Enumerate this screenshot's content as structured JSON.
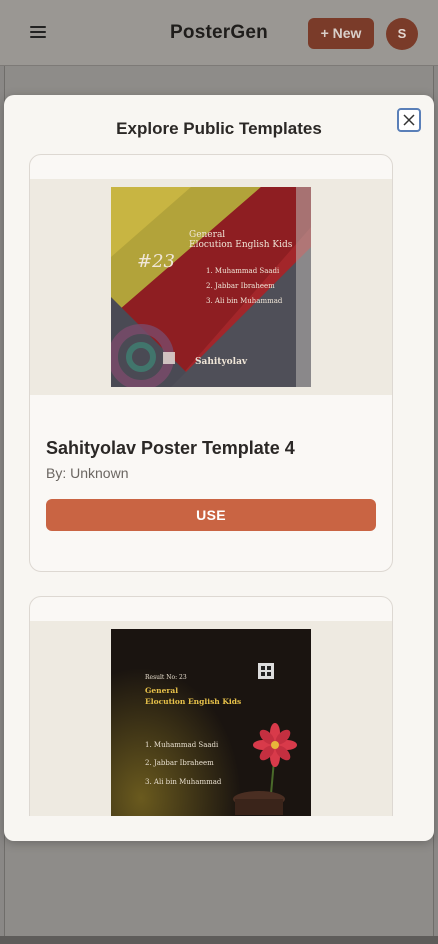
{
  "header": {
    "brand": "PosterGen",
    "new_button": "+ New",
    "avatar_initial": "S",
    "menu_icon": "hamburger-icon"
  },
  "modal": {
    "title": "Explore Public Templates",
    "close_icon": "close-icon"
  },
  "templates": [
    {
      "name": "Sahityolav Poster Template 4",
      "author": "By: Unknown",
      "use_label": "USE",
      "poster": {
        "number": "#23",
        "heading_line1": "General",
        "heading_line2": "Elocution English Kids",
        "entries": [
          "1. Muhammad Saadi",
          "2. Jabbar Ibraheem",
          "3. Ali bin Muhammad"
        ],
        "footer": "Sahityolav"
      }
    },
    {
      "name": "",
      "author": "",
      "use_label": "",
      "poster": {
        "result_no": "Result No: 23",
        "heading_line1": "General",
        "heading_line2": "Elocution English Kids",
        "entries": [
          "1. Muhammad Saadi",
          "2. Jabbar Ibraheem",
          "3. Ali bin Muhammad"
        ]
      }
    }
  ],
  "colors": {
    "accent": "#c96443",
    "accent_dark": "#7a3b29",
    "modal_bg": "#f8f6f2",
    "thumb_bg": "#eeeae1"
  }
}
